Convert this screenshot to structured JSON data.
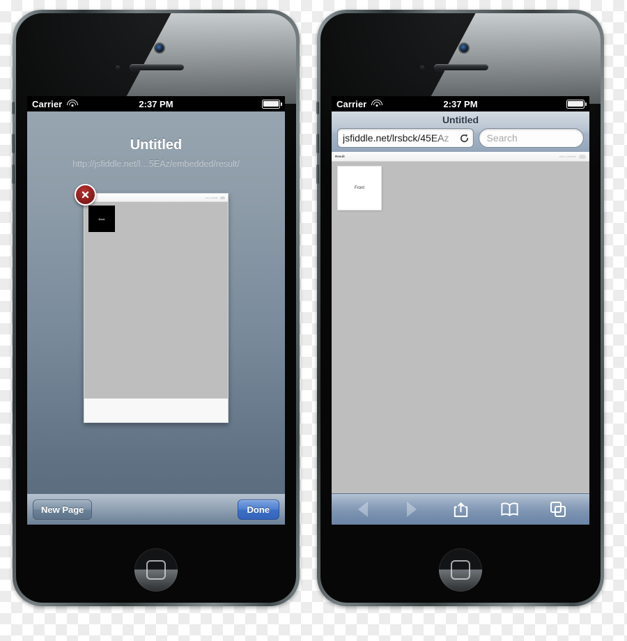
{
  "phone_left": {
    "name": "iphone-tabs-overview",
    "status_bar": {
      "carrier": "Carrier",
      "time": "2:37 PM",
      "wifi_icon": "wifi-icon",
      "battery_icon": "battery-full-icon"
    },
    "tabs_view": {
      "page_title": "Untitled",
      "page_url": "http://jsfiddle.net/l…5EAz/embedded/result/",
      "close_icon": "close-tab-icon",
      "thumbnail": {
        "card_label": "Back",
        "chrome_hint": "edit in jsfiddle",
        "cloud_icon": "cloud-icon"
      }
    },
    "toolbar": {
      "new_page_label": "New Page",
      "done_label": "Done"
    }
  },
  "phone_right": {
    "name": "iphone-safari-browser",
    "status_bar": {
      "carrier": "Carrier",
      "time": "2:37 PM",
      "wifi_icon": "wifi-icon",
      "battery_icon": "battery-full-icon"
    },
    "nav_bar": {
      "title": "Untitled",
      "url_value": "jsfiddle.net/lrsbck/45EAz",
      "reload_icon": "reload-icon",
      "search_placeholder": "Search"
    },
    "content": {
      "result_label": "Result",
      "edit_hint": "edit in jsfiddle",
      "cloud_icon": "cloud-icon",
      "card_label": "Front"
    },
    "toolbar": {
      "back_icon": "back-arrow-icon",
      "forward_icon": "forward-arrow-icon",
      "share_icon": "share-icon",
      "bookmarks_icon": "bookmarks-book-icon",
      "tabs_icon": "tabs-icon"
    }
  },
  "colors": {
    "tabs_bg_top": "#97a5b1",
    "tabs_bg_bottom": "#576a7b",
    "done_blue": "#3d6fc6",
    "close_red": "#8d1c1c",
    "content_gray": "#bebebe"
  }
}
